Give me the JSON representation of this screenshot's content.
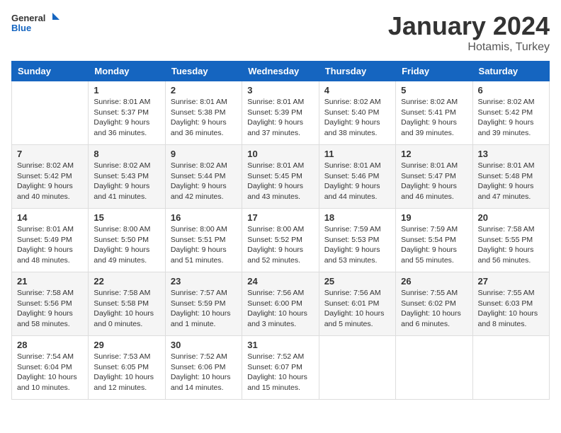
{
  "header": {
    "logo_general": "General",
    "logo_blue": "Blue",
    "title": "January 2024",
    "subtitle": "Hotamis, Turkey"
  },
  "weekdays": [
    "Sunday",
    "Monday",
    "Tuesday",
    "Wednesday",
    "Thursday",
    "Friday",
    "Saturday"
  ],
  "weeks": [
    [
      {
        "day": "",
        "info": ""
      },
      {
        "day": "1",
        "info": "Sunrise: 8:01 AM\nSunset: 5:37 PM\nDaylight: 9 hours\nand 36 minutes."
      },
      {
        "day": "2",
        "info": "Sunrise: 8:01 AM\nSunset: 5:38 PM\nDaylight: 9 hours\nand 36 minutes."
      },
      {
        "day": "3",
        "info": "Sunrise: 8:01 AM\nSunset: 5:39 PM\nDaylight: 9 hours\nand 37 minutes."
      },
      {
        "day": "4",
        "info": "Sunrise: 8:02 AM\nSunset: 5:40 PM\nDaylight: 9 hours\nand 38 minutes."
      },
      {
        "day": "5",
        "info": "Sunrise: 8:02 AM\nSunset: 5:41 PM\nDaylight: 9 hours\nand 39 minutes."
      },
      {
        "day": "6",
        "info": "Sunrise: 8:02 AM\nSunset: 5:42 PM\nDaylight: 9 hours\nand 39 minutes."
      }
    ],
    [
      {
        "day": "7",
        "info": ""
      },
      {
        "day": "8",
        "info": "Sunrise: 8:02 AM\nSunset: 5:43 PM\nDaylight: 9 hours\nand 41 minutes."
      },
      {
        "day": "9",
        "info": "Sunrise: 8:02 AM\nSunset: 5:44 PM\nDaylight: 9 hours\nand 42 minutes."
      },
      {
        "day": "10",
        "info": "Sunrise: 8:01 AM\nSunset: 5:45 PM\nDaylight: 9 hours\nand 43 minutes."
      },
      {
        "day": "11",
        "info": "Sunrise: 8:01 AM\nSunset: 5:46 PM\nDaylight: 9 hours\nand 44 minutes."
      },
      {
        "day": "12",
        "info": "Sunrise: 8:01 AM\nSunset: 5:47 PM\nDaylight: 9 hours\nand 46 minutes."
      },
      {
        "day": "13",
        "info": "Sunrise: 8:01 AM\nSunset: 5:48 PM\nDaylight: 9 hours\nand 47 minutes."
      }
    ],
    [
      {
        "day": "14",
        "info": ""
      },
      {
        "day": "15",
        "info": "Sunrise: 8:00 AM\nSunset: 5:50 PM\nDaylight: 9 hours\nand 49 minutes."
      },
      {
        "day": "16",
        "info": "Sunrise: 8:00 AM\nSunset: 5:51 PM\nDaylight: 9 hours\nand 51 minutes."
      },
      {
        "day": "17",
        "info": "Sunrise: 8:00 AM\nSunset: 5:52 PM\nDaylight: 9 hours\nand 52 minutes."
      },
      {
        "day": "18",
        "info": "Sunrise: 7:59 AM\nSunset: 5:53 PM\nDaylight: 9 hours\nand 53 minutes."
      },
      {
        "day": "19",
        "info": "Sunrise: 7:59 AM\nSunset: 5:54 PM\nDaylight: 9 hours\nand 55 minutes."
      },
      {
        "day": "20",
        "info": "Sunrise: 7:58 AM\nSunset: 5:55 PM\nDaylight: 9 hours\nand 56 minutes."
      }
    ],
    [
      {
        "day": "21",
        "info": ""
      },
      {
        "day": "22",
        "info": "Sunrise: 7:58 AM\nSunset: 5:58 PM\nDaylight: 10 hours\nand 0 minutes."
      },
      {
        "day": "23",
        "info": "Sunrise: 7:57 AM\nSunset: 5:59 PM\nDaylight: 10 hours\nand 1 minute."
      },
      {
        "day": "24",
        "info": "Sunrise: 7:56 AM\nSunset: 6:00 PM\nDaylight: 10 hours\nand 3 minutes."
      },
      {
        "day": "25",
        "info": "Sunrise: 7:56 AM\nSunset: 6:01 PM\nDaylight: 10 hours\nand 5 minutes."
      },
      {
        "day": "26",
        "info": "Sunrise: 7:55 AM\nSunset: 6:02 PM\nDaylight: 10 hours\nand 6 minutes."
      },
      {
        "day": "27",
        "info": "Sunrise: 7:55 AM\nSunset: 6:03 PM\nDaylight: 10 hours\nand 8 minutes."
      }
    ],
    [
      {
        "day": "28",
        "info": "Sunrise: 7:54 AM\nSunset: 6:04 PM\nDaylight: 10 hours\nand 10 minutes."
      },
      {
        "day": "29",
        "info": "Sunrise: 7:53 AM\nSunset: 6:05 PM\nDaylight: 10 hours\nand 12 minutes."
      },
      {
        "day": "30",
        "info": "Sunrise: 7:52 AM\nSunset: 6:06 PM\nDaylight: 10 hours\nand 14 minutes."
      },
      {
        "day": "31",
        "info": "Sunrise: 7:52 AM\nSunset: 6:07 PM\nDaylight: 10 hours\nand 15 minutes."
      },
      {
        "day": "",
        "info": ""
      },
      {
        "day": "",
        "info": ""
      },
      {
        "day": "",
        "info": ""
      }
    ]
  ],
  "week1_sun": {
    "info": ""
  },
  "week2_sun": {
    "info": "Sunrise: 8:02 AM\nSunset: 5:42 PM\nDaylight: 9 hours\nand 40 minutes."
  },
  "week3_sun": {
    "info": "Sunrise: 8:01 AM\nSunset: 5:49 PM\nDaylight: 9 hours\nand 48 minutes."
  },
  "week4_sun": {
    "info": "Sunrise: 7:58 AM\nSunset: 5:56 PM\nDaylight: 9 hours\nand 58 minutes."
  }
}
